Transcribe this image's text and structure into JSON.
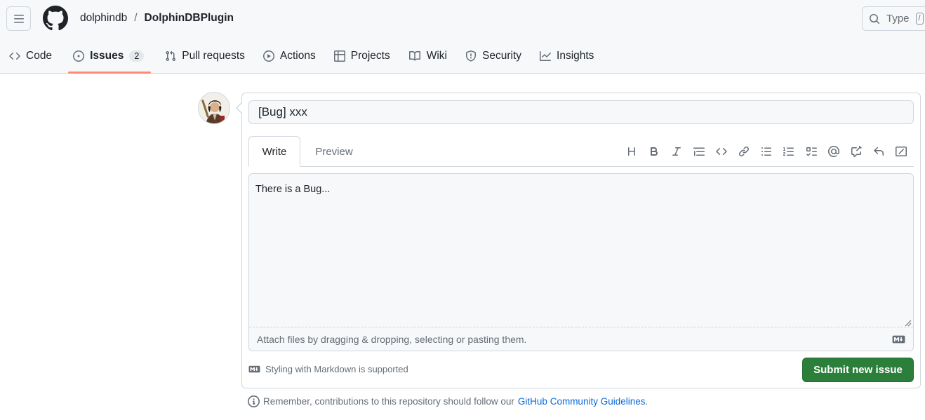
{
  "header": {
    "owner": "dolphindb",
    "separator": "/",
    "repo": "DolphinDBPlugin",
    "search_placeholder": "Type",
    "search_key": "/"
  },
  "tabs": [
    {
      "label": "Code",
      "icon": "code-icon"
    },
    {
      "label": "Issues",
      "icon": "issue-opened-icon",
      "count": "2",
      "selected": true
    },
    {
      "label": "Pull requests",
      "icon": "git-pull-request-icon"
    },
    {
      "label": "Actions",
      "icon": "play-icon"
    },
    {
      "label": "Projects",
      "icon": "table-icon"
    },
    {
      "label": "Wiki",
      "icon": "book-icon"
    },
    {
      "label": "Security",
      "icon": "shield-icon"
    },
    {
      "label": "Insights",
      "icon": "graph-icon"
    }
  ],
  "form": {
    "title_value": "[Bug] xxx",
    "write_tab": "Write",
    "preview_tab": "Preview",
    "body_value": "There is a Bug...",
    "attach_hint": "Attach files by dragging & dropping, selecting or pasting them.",
    "markdown_note": "Styling with Markdown is supported",
    "submit_label": "Submit new issue"
  },
  "toolbar": [
    "heading-icon",
    "bold-icon",
    "italic-icon",
    "quote-icon",
    "code-icon",
    "link-icon",
    "unordered-list-icon",
    "ordered-list-icon",
    "tasklist-icon",
    "mention-icon",
    "cross-reference-icon",
    "reply-icon",
    "slash-command-icon"
  ],
  "footer": {
    "guideline_text": "Remember, contributions to this repository should follow our",
    "guideline_link": "GitHub Community Guidelines",
    "guideline_end": "."
  },
  "colors": {
    "accent_underline": "#fd8c73",
    "submit_bg": "#2c7f3a",
    "link": "#0969da"
  }
}
